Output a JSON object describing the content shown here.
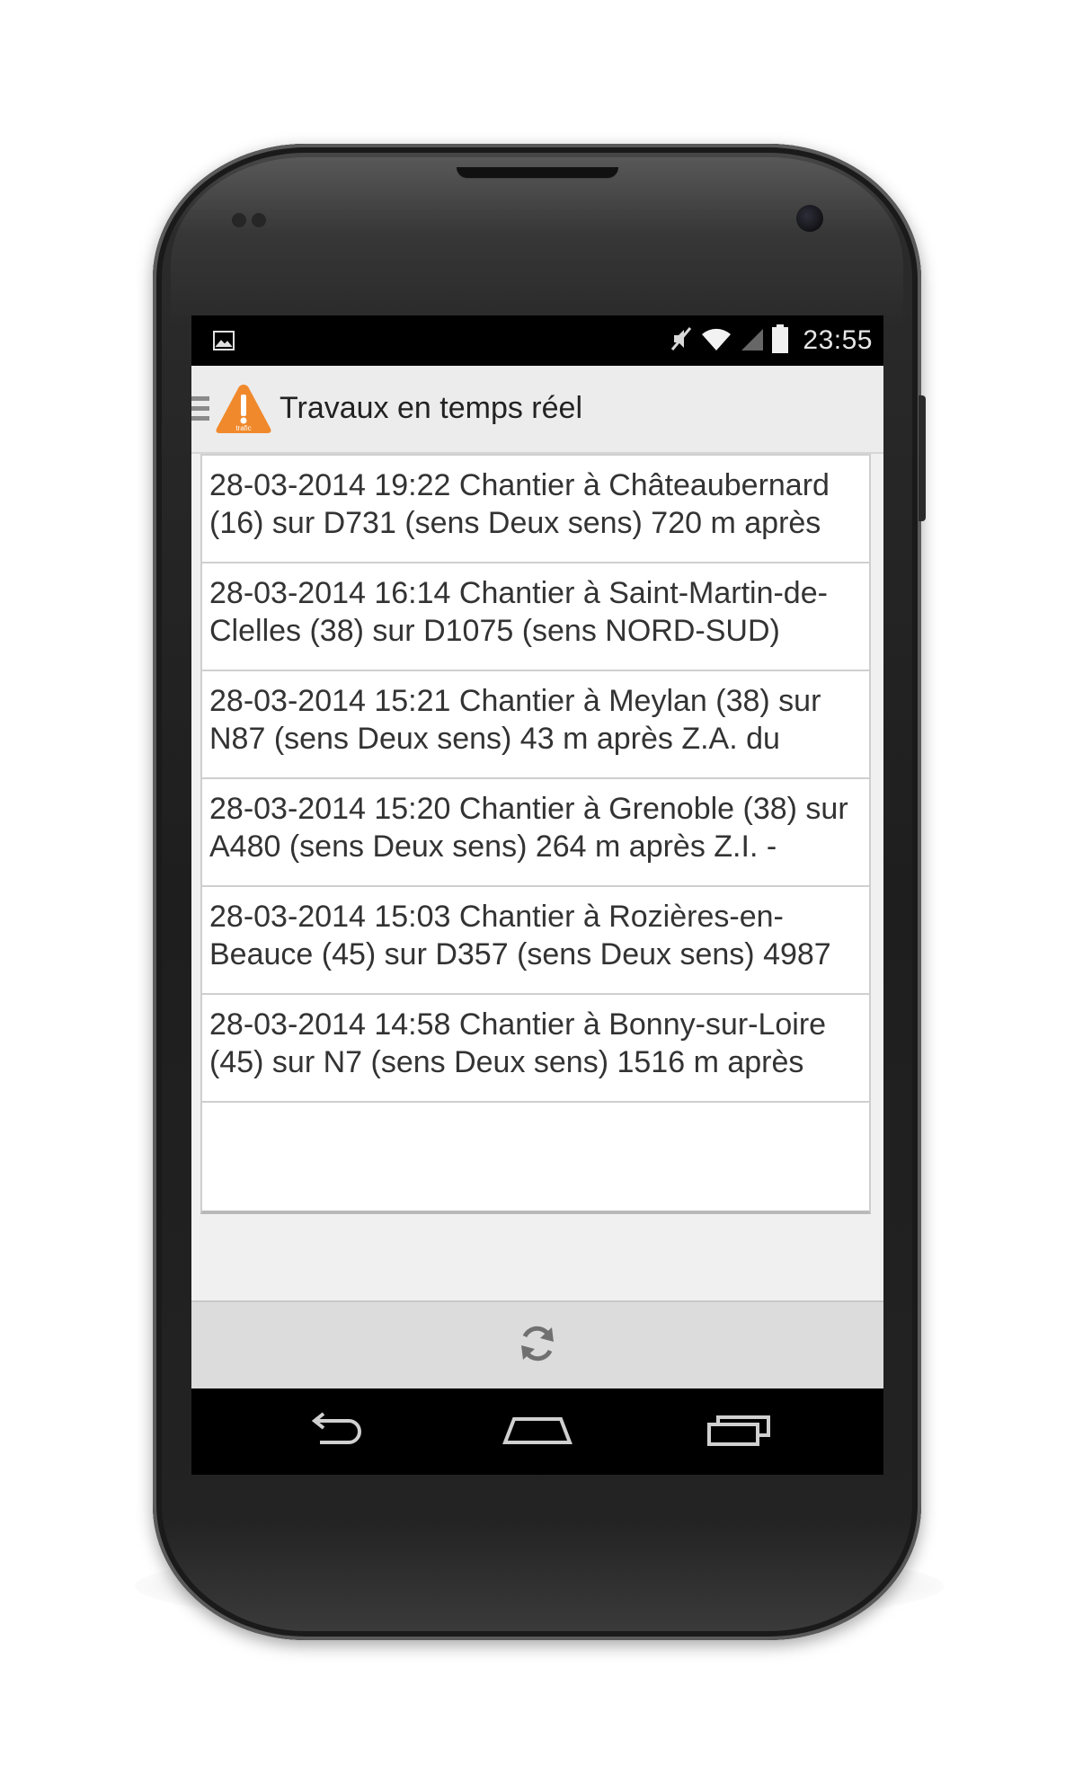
{
  "status_bar": {
    "time": "23:55",
    "icons": [
      "image-notification-icon",
      "mute-icon",
      "wifi-icon",
      "signal-icon",
      "battery-icon"
    ]
  },
  "action_bar": {
    "title": "Travaux en temps réel",
    "app_icon_label": "trafic",
    "accent_color": "#f0892b"
  },
  "list": {
    "items": [
      "28-03-2014 19:22 Chantier à Châteaubernard (16) sur D731 (sens Deux sens) 720 m après",
      "28-03-2014 16:14 Chantier à Saint-Martin-de-Clelles (38) sur D1075 (sens NORD-SUD)",
      "28-03-2014 15:21 Chantier à Meylan (38) sur N87 (sens Deux sens) 43 m après Z.A. du",
      "28-03-2014 15:20 Chantier à Grenoble (38) sur A480 (sens Deux sens) 264 m après Z.I. -",
      "28-03-2014 15:03 Chantier à Rozières-en-Beauce (45) sur D357 (sens Deux sens) 4987",
      "28-03-2014 14:58 Chantier à Bonny-sur-Loire (45) sur N7 (sens Deux sens) 1516 m après",
      ""
    ]
  },
  "bottom_bar": {
    "refresh_icon": "refresh-icon"
  },
  "nav_bar": {
    "icons": [
      "back-icon",
      "home-icon",
      "recent-apps-icon"
    ]
  }
}
